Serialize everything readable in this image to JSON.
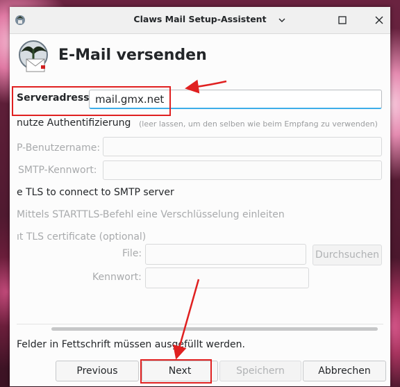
{
  "window": {
    "title": "Claws Mail Setup-Assistent",
    "minimize_icon": "chevron-down-icon",
    "maximize_icon": "square-icon",
    "close_icon": "close-icon"
  },
  "page": {
    "heading": "E-Mail versenden"
  },
  "form": {
    "server_label": "Serveradresse",
    "server_value": "mail.gmx.net",
    "auth_label": "nutze Authentifizierung",
    "auth_hint": "(leer lassen, um den selben wie beim Empfang zu verwenden)",
    "username_label": "P-Benutzername:",
    "password_label": "SMTP-Kennwort:",
    "tls_label": "e TLS to connect to SMTP server",
    "starttls_label": "Mittels STARTTLS-Befehl eine Verschlüsselung einleiten",
    "cert_label": "ıt TLS certificate (optional)",
    "file_label": "File:",
    "browse_label": "Durchsuchen",
    "cert_password_label": "Kennwort:"
  },
  "footer": {
    "note": "Felder in Fettschrift müssen ausgefüllt werden."
  },
  "buttons": {
    "previous": "Previous",
    "next": "Next",
    "save": "Speichern",
    "cancel": "Abbrechen"
  },
  "annotation_color": "#e02020"
}
